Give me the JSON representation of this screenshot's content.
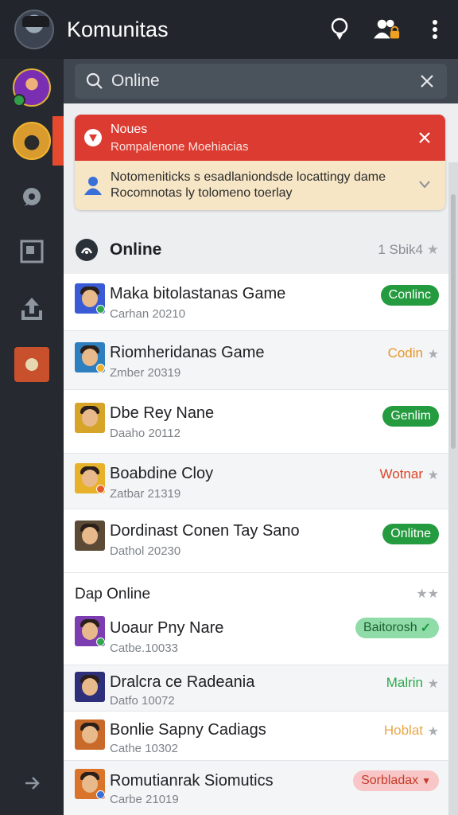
{
  "header": {
    "title": "Komunitas",
    "icons": [
      "avatar",
      "bulb-icon",
      "friends-lock-icon",
      "more-vertical-icon"
    ]
  },
  "search": {
    "value": "Online"
  },
  "notice": {
    "title": "Noues",
    "subtitle": "Rompalenone Moehiacias",
    "message_line1": "Notomeniticks s esadlaniondsde locattingy dame",
    "message_line2": "Rocomnotas ly tolomeno toerlay"
  },
  "online_section": {
    "title": "Online",
    "count": "1 Sbik4",
    "players": [
      {
        "name": "Maka bitolastanas Game",
        "sub": "Carhan 20210",
        "status": "Conlinc",
        "status_style": "pill-green",
        "avatar_bg": "#3b5bd6"
      },
      {
        "name": "Riomheridanas Game",
        "sub": "Zmber 20319",
        "status": "Codin",
        "status_style": "text-orange",
        "avatar_bg": "#2d7fbf"
      },
      {
        "name": "Dbe Rey Nane",
        "sub": "Daaho 20112",
        "status": "Genlim",
        "status_style": "pill-green",
        "avatar_bg": "#d7a42a"
      },
      {
        "name": "Boabdine Cloy",
        "sub": "Zatbar 21319",
        "status": "Wotnar",
        "status_style": "text-red",
        "avatar_bg": "#e7b12a"
      },
      {
        "name": "Dordinast Conen Tay Sano",
        "sub": "Dathol 20230",
        "status": "Onlitne",
        "status_style": "pill-green",
        "avatar_bg": "#5a4a36"
      }
    ]
  },
  "dap_section": {
    "title": "Dap Online",
    "players": [
      {
        "name": "Uoaur Pny Nare",
        "sub": "Catbe.10033",
        "status": "Baitorosh",
        "status_style": "pill-lightgreen",
        "avatar_bg": "#7b3db0"
      },
      {
        "name": "Dralcra ce Radeania",
        "sub": "Datfo 10072",
        "status": "Malrin",
        "status_style": "text-green",
        "avatar_bg": "#2e2f7a"
      },
      {
        "name": "Bonlie Sapny Cadiags",
        "sub": "Cathe 10302",
        "status": "Hoblat",
        "status_style": "text-gold",
        "avatar_bg": "#c96a2a"
      },
      {
        "name": "Romutianrak Siomutics",
        "sub": "Carbe 21019",
        "status": "Sorbladax",
        "status_style": "pill-pink",
        "avatar_bg": "#d9742a"
      }
    ]
  },
  "sidebar": {
    "items": [
      "avatar-1",
      "avatar-2-active",
      "chat-icon",
      "calendar-icon",
      "share-icon",
      "game-avatar",
      "arrow-icon"
    ]
  },
  "colors": {
    "topbar": "#22262c",
    "sidebar": "#262a30",
    "notice_red": "#db3b30",
    "notice_cream": "#f7e6c6",
    "online_green": "#239b3e",
    "accent_orange": "#e64a2e"
  }
}
